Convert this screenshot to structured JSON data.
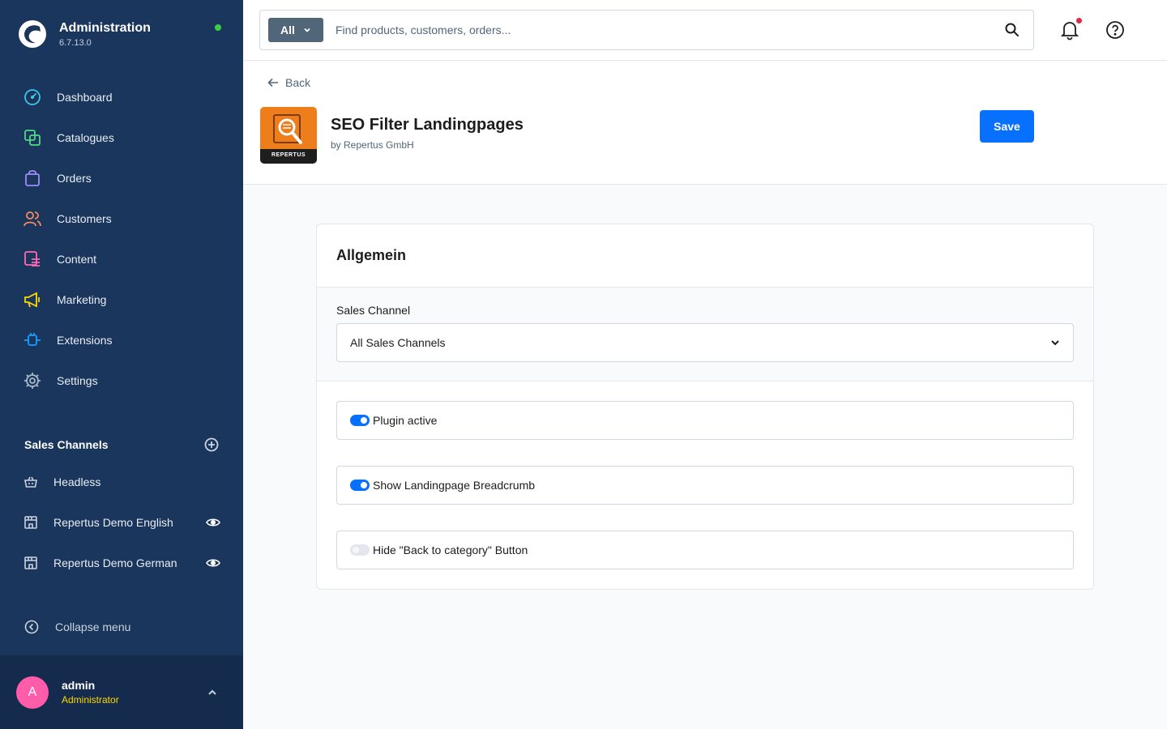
{
  "app": {
    "title": "Administration",
    "version": "6.7.13.0"
  },
  "nav": [
    {
      "label": "Dashboard",
      "icon": "dashboard-icon",
      "color": "#3fc4e3"
    },
    {
      "label": "Catalogues",
      "icon": "catalogue-icon",
      "color": "#52d986"
    },
    {
      "label": "Orders",
      "icon": "orders-icon",
      "color": "#9d8cfb"
    },
    {
      "label": "Customers",
      "icon": "customers-icon",
      "color": "#f88962"
    },
    {
      "label": "Content",
      "icon": "content-icon",
      "color": "#ff68b4"
    },
    {
      "label": "Marketing",
      "icon": "marketing-icon",
      "color": "#ffd700"
    },
    {
      "label": "Extensions",
      "icon": "extensions-icon",
      "color": "#189eff"
    },
    {
      "label": "Settings",
      "icon": "settings-icon",
      "color": "#a8b8c8"
    }
  ],
  "sales_channels": {
    "title": "Sales Channels",
    "items": [
      {
        "label": "Headless",
        "icon": "basket-icon"
      },
      {
        "label": "Repertus Demo English",
        "icon": "storefront-icon"
      },
      {
        "label": "Repertus Demo German",
        "icon": "storefront-icon"
      }
    ]
  },
  "collapse_label": "Collapse menu",
  "user": {
    "initial": "A",
    "name": "admin",
    "role": "Administrator"
  },
  "search": {
    "type": "All",
    "placeholder": "Find products, customers, orders..."
  },
  "header": {
    "back": "Back",
    "plugin_title": "SEO Filter Landingpages",
    "plugin_author": "by Repertus GmbH",
    "logo_text": "REPERTUS",
    "save": "Save"
  },
  "card": {
    "title": "Allgemein",
    "sales_channel_label": "Sales Channel",
    "sales_channel_value": "All Sales Channels",
    "toggles": [
      {
        "label": "Plugin active",
        "on": true
      },
      {
        "label": "Show Landingpage Breadcrumb",
        "on": true
      },
      {
        "label": "Hide \"Back to category\" Button",
        "on": false
      }
    ]
  },
  "colors": {
    "sidebar": "#1b365d",
    "accent": "#0870ff",
    "online": "#37d046"
  }
}
